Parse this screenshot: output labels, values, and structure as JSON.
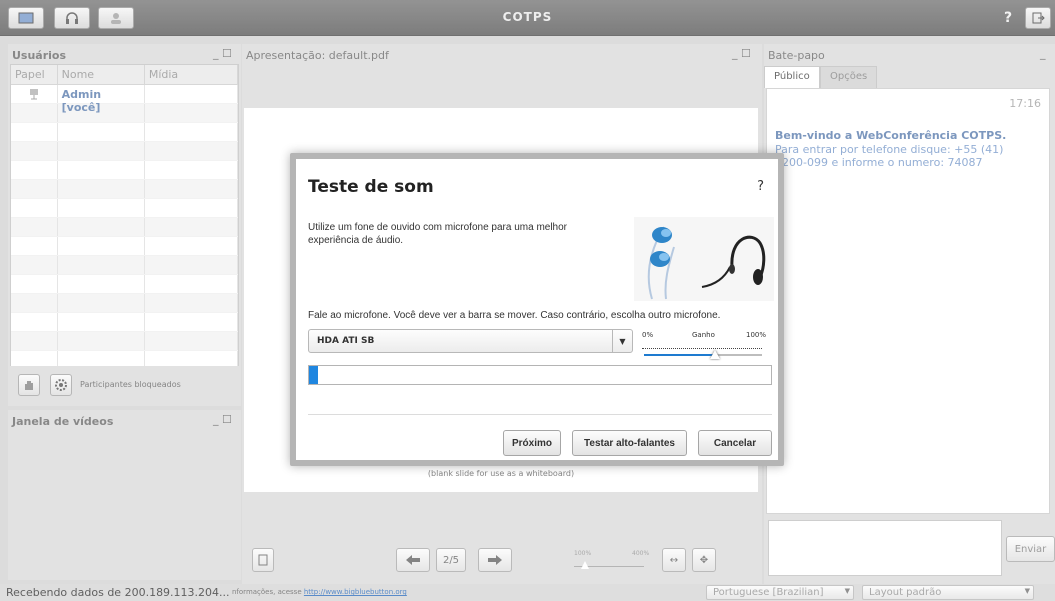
{
  "app": {
    "title": "COTPS",
    "help": "?"
  },
  "users_panel": {
    "title": "Usuários",
    "columns": [
      "Papel",
      "Nome",
      "Mídia"
    ],
    "rows": [
      {
        "role_icon": "presenter-icon",
        "name": "Admin [você]",
        "media": ""
      }
    ],
    "locked_label": "Participantes bloqueados",
    "ctl": "_ ☐"
  },
  "video_panel": {
    "title": "Janela de vídeos",
    "ctl": "_ ☐"
  },
  "presentation": {
    "title": "Apresentação: default.pdf",
    "ctl": "_ ☐",
    "slide_caption": "(blank slide for use as a whiteboard)",
    "page": "2/5",
    "zoom_min": "100%",
    "zoom_max": "400%",
    "zoom_level": 0.1
  },
  "chat": {
    "title": "Bate-papo",
    "ctl": "_",
    "tabs": [
      "Público",
      "Opções"
    ],
    "time": "17:16",
    "welcome": "Bem-vindo a WebConferência COTPS.",
    "info": "Para entrar por telefone disque: +55 (41) 3200-⁠099 e informe o numero: 74087",
    "send_label": "Enviar"
  },
  "dialog": {
    "title": "Teste de som",
    "help": "?",
    "intro": "Utilize um fone de ouvido com microfone para uma melhor experiência de áudio.",
    "instruction": "Fale ao microfone. Você deve ver a barra se mover. Caso contrário, escolha outro microfone.",
    "mic_value": "HDA ATI SB",
    "gain_min": "0%",
    "gain_label": "Ganho",
    "gain_max": "100%",
    "gain_level": 0.6,
    "mic_level": 0.02,
    "buttons": {
      "next": "Próximo",
      "test_speakers": "Testar alto-falantes",
      "cancel": "Cancelar"
    }
  },
  "statusbar": {
    "status": "Recebendo dados de 200.189.113.204...",
    "info_prefix": "nformações, acesse",
    "info_link": "http://www.bigbluebutton.org",
    "language": "Portuguese [Brazilian]",
    "layout": "Layout padrão"
  },
  "colors": {
    "accent_blue": "#1f86e0",
    "link_blue": "#4a6fa5"
  }
}
